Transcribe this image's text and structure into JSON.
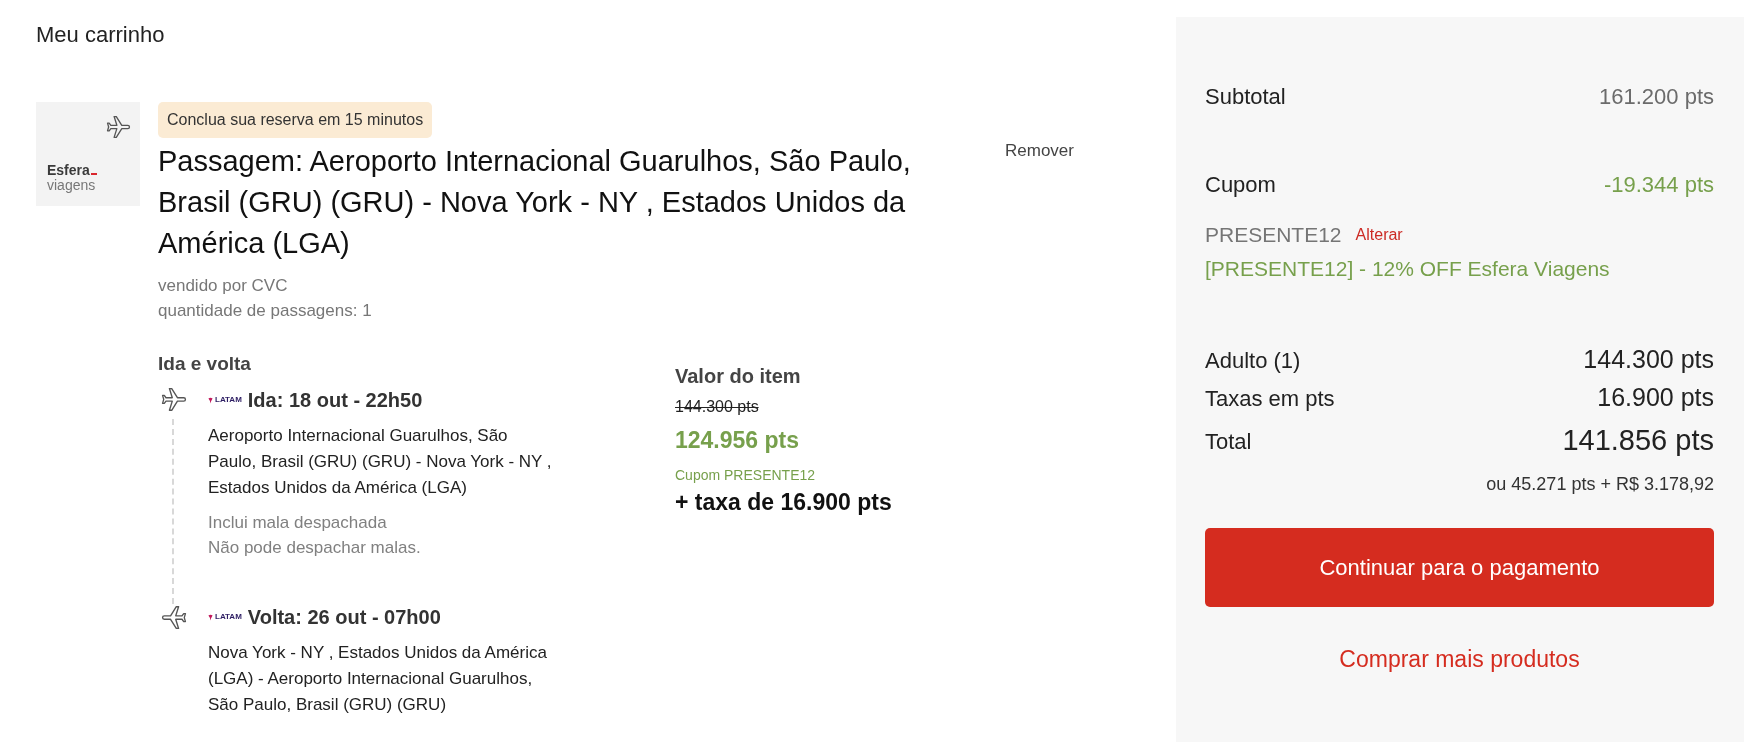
{
  "page_title": "Meu carrinho",
  "cart_item": {
    "thumbnail": {
      "brand": "Esfera",
      "tagline": "viagens"
    },
    "timer_badge": "Conclua sua reserva em 15 minutos",
    "title": "Passagem: Aeroporto Internacional Guarulhos, São Paulo, Brasil (GRU) (GRU) - Nova York - NY , Estados Unidos da América (LGA)",
    "remove_link": "Remover",
    "details": [
      "vendido por CVC",
      "quantidade de passagens: 1"
    ],
    "itinerary": {
      "heading": "Ida e volta",
      "legs": [
        {
          "kind": "outbound",
          "airline": "LATAM",
          "title": "Ida: 18 out - 22h50",
          "route": "Aeroporto Internacional Guarulhos, São Paulo, Brasil (GRU) (GRU) - Nova York - NY , Estados Unidos da América (LGA)",
          "notes": [
            "Inclui mala despachada",
            "Não pode despachar malas."
          ]
        },
        {
          "kind": "return",
          "airline": "LATAM",
          "title": "Volta: 26 out - 07h00",
          "route": "Nova York - NY , Estados Unidos da América (LGA) - Aeroporto Internacional Guarulhos, São Paulo, Brasil (GRU) (GRU)"
        }
      ]
    },
    "price": {
      "heading": "Valor do item",
      "original": "144.300 pts",
      "discounted": "124.956 pts",
      "coupon_note": "Cupom PRESENTE12",
      "fee": "+ taxa de 16.900 pts"
    }
  },
  "summary": {
    "subtotal": {
      "label": "Subtotal",
      "value": "161.200 pts"
    },
    "coupon": {
      "label": "Cupom",
      "value": "-19.344 pts",
      "code": "PRESENTE12",
      "change_link": "Alterar",
      "description": "[PRESENTE12] - 12% OFF Esfera Viagens"
    },
    "lines": [
      {
        "label": "Adulto (1)",
        "value": "144.300 pts"
      },
      {
        "label": "Taxas em pts",
        "value": "16.900 pts"
      }
    ],
    "total": {
      "label": "Total",
      "value": "141.856 pts",
      "alternative": "ou 45.271 pts + R$ 3.178,92"
    },
    "primary_button": "Continuar para o pagamento",
    "secondary_link": "Comprar mais produtos"
  }
}
